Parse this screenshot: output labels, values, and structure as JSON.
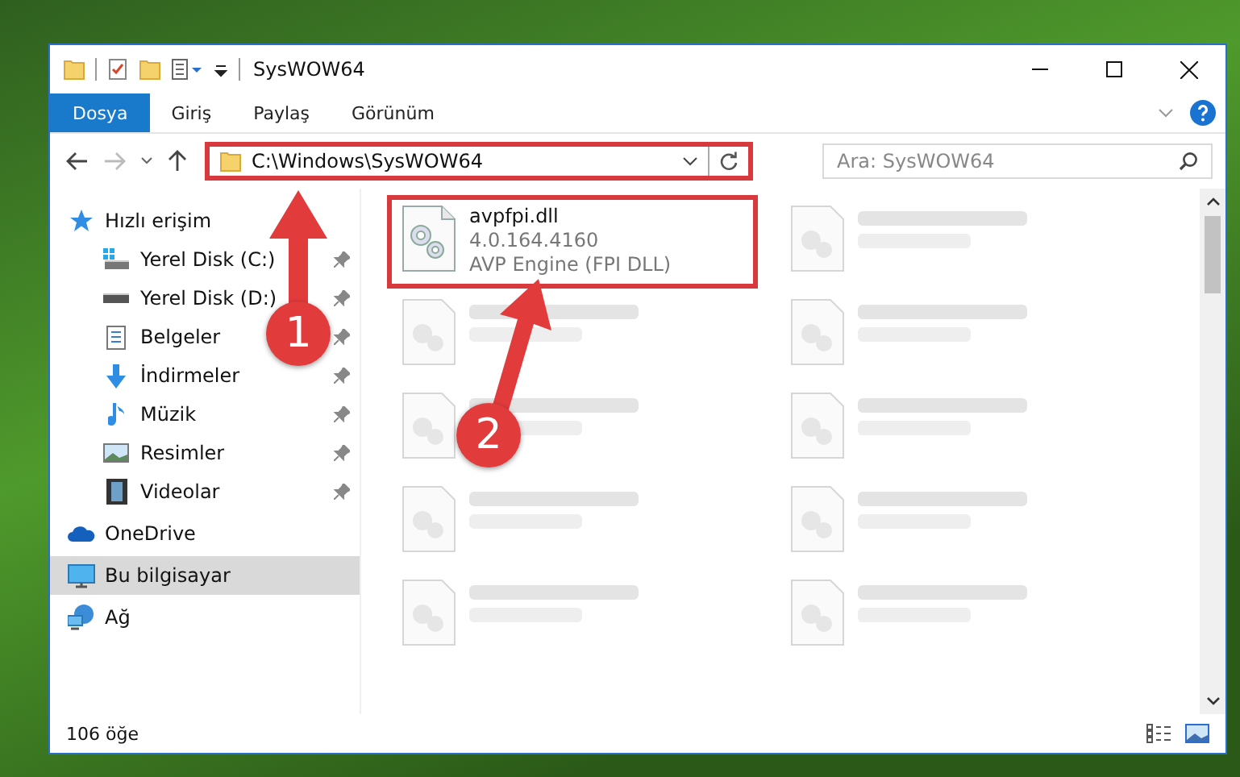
{
  "window": {
    "title": "SysWOW64"
  },
  "ribbon_tabs": [
    {
      "label": "Dosya",
      "selected": true
    },
    {
      "label": "Giriş",
      "selected": false
    },
    {
      "label": "Paylaş",
      "selected": false
    },
    {
      "label": "Görünüm",
      "selected": false
    }
  ],
  "address_bar": {
    "path": "C:\\Windows\\SysWOW64",
    "highlighted": true
  },
  "search": {
    "placeholder": "Ara: SysWOW64"
  },
  "navigation": [
    {
      "label": "Hızlı erişim",
      "selected": false,
      "children": [
        {
          "label": "Yerel Disk (C:)",
          "pinned": true,
          "selected": false
        },
        {
          "label": "Yerel Disk (D:)",
          "pinned": true,
          "selected": false
        },
        {
          "label": "Belgeler",
          "pinned": true,
          "selected": false
        },
        {
          "label": "İndirmeler",
          "pinned": true,
          "selected": false
        },
        {
          "label": "Müzik",
          "pinned": true,
          "selected": false
        },
        {
          "label": "Resimler",
          "pinned": true,
          "selected": false
        },
        {
          "label": "Videolar",
          "pinned": true,
          "selected": false
        }
      ]
    },
    {
      "label": "OneDrive",
      "selected": false
    },
    {
      "label": "Bu bilgisayar",
      "selected": true
    },
    {
      "label": "Ağ",
      "selected": false
    }
  ],
  "files": [
    {
      "name": "avpfpi.dll",
      "details": [
        "4.0.164.4160",
        "AVP Engine (FPI DLL)"
      ],
      "faded": false,
      "highlighted": true
    },
    {
      "faded": true,
      "highlighted": false
    },
    {
      "faded": true,
      "highlighted": false
    },
    {
      "faded": true,
      "highlighted": false
    },
    {
      "faded": true,
      "highlighted": false
    },
    {
      "faded": true,
      "highlighted": false
    },
    {
      "faded": true,
      "highlighted": false
    },
    {
      "faded": true,
      "highlighted": false
    },
    {
      "faded": true,
      "highlighted": false
    },
    {
      "faded": true,
      "highlighted": false
    }
  ],
  "status_bar": {
    "item_count": "106 öğe"
  },
  "annotations": [
    {
      "label": "1"
    },
    {
      "label": "2"
    }
  ]
}
